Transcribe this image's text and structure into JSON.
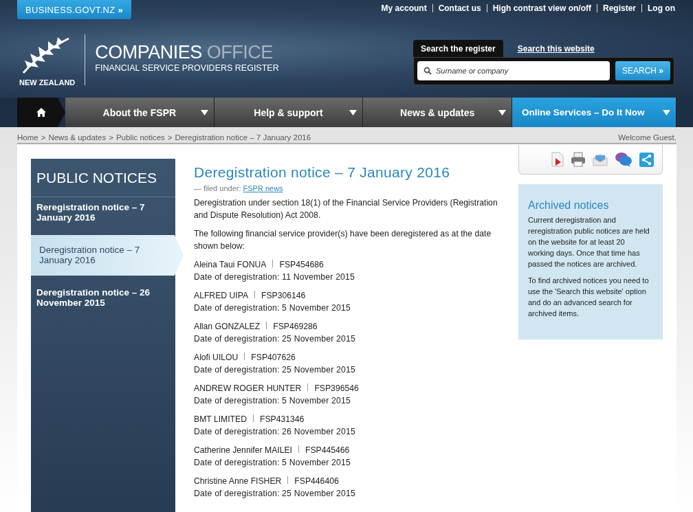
{
  "header": {
    "business_link": "BUSINESS.GOVT.NZ",
    "business_arrow": "»",
    "top_links": [
      "My account",
      "Contact us",
      "High contrast view on/off",
      "Register",
      "Log on"
    ],
    "logo": {
      "country": "NEW ZEALAND",
      "title_main": "COMPANIES",
      "title_light": "OFFICE",
      "subtitle": "FINANCIAL SERVICE PROVIDERS REGISTER"
    },
    "search": {
      "tabs": [
        {
          "label": "Search the register",
          "selected": true
        },
        {
          "label": "Search this website",
          "selected": false
        }
      ],
      "placeholder": "Surname or company",
      "button": "SEARCH",
      "button_arrow": "»"
    }
  },
  "nav": [
    {
      "label": "About the FSPR",
      "highlighted": false
    },
    {
      "label": "Help & support",
      "highlighted": false
    },
    {
      "label": "News & updates",
      "highlighted": false
    },
    {
      "label": "Online Services – Do It Now",
      "highlighted": true
    }
  ],
  "breadcrumb": {
    "items": [
      "Home",
      "News & updates",
      "Public notices"
    ],
    "separator": ">",
    "current": "Deregistration notice – 7 January 2016",
    "welcome": "Welcome Guest."
  },
  "sidebar": {
    "title": "PUBLIC NOTICES",
    "items": [
      {
        "label": "Reregistration notice – 7 January 2016",
        "selected": false
      },
      {
        "label": "Deregistration notice – 7 January 2016",
        "selected": true
      },
      {
        "label": "Deregistration notice – 26 November 2015",
        "selected": false
      }
    ]
  },
  "article": {
    "title": "Deregistration notice – 7 January 2016",
    "filed_prefix": "— filed under:",
    "filed_link": "FSPR news",
    "intro": "Deregistration under section 18(1) of the Financial Service Providers (Registration and Dispute Resolution) Act 2008.",
    "lead": "The following financial service provider(s) have been deregistered as at the date shown below:",
    "entries": [
      {
        "name": "Aleina Taui FONUA",
        "fsp": "FSP454686",
        "date": "Date of deregistration:  11 November 2015"
      },
      {
        "name": "ALFRED UIPA",
        "fsp": "FSP306146",
        "date": "Date of deregistration:  5 November 2015"
      },
      {
        "name": "Allan GONZALEZ",
        "fsp": "FSP469286",
        "date": "Date of deregistration:  25 November 2015"
      },
      {
        "name": "Alofi UILOU",
        "fsp": "FSP407626",
        "date": "Date of deregistration:  25 November 2015"
      },
      {
        "name": "ANDREW ROGER HUNTER",
        "fsp": "FSP396546",
        "date": "Date of deregistration:  5 November 2015"
      },
      {
        "name": "BMT LIMITED",
        "fsp": "FSP431346",
        "date": "Date of deregistration:  26 November 2015"
      },
      {
        "name": "Catherine Jennifer MAILEI",
        "fsp": "FSP445466",
        "date": "Date of deregistration:  5 November 2015"
      },
      {
        "name": "Christine Anne FISHER",
        "fsp": "FSP446406",
        "date": "Date of deregistration:  25 November 2015"
      }
    ]
  },
  "aside": {
    "title": "Archived notices",
    "paragraphs": [
      "Current deregistration and reregistration public notices are held on the website for at least 20 working days. Once that time has passed the notices are archived.",
      "To find archived notices you need to use the 'Search this website' option and do an advanced search for archived items."
    ]
  }
}
